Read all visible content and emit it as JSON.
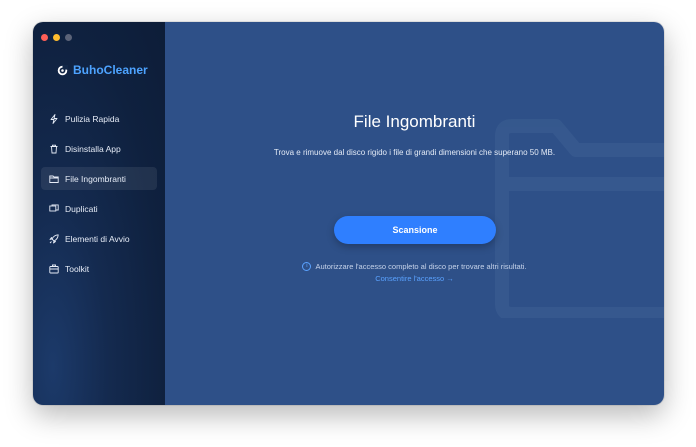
{
  "app": {
    "name": "BuhoCleaner",
    "accent_color": "#2f7fff",
    "brand_color": "#4da3ff"
  },
  "window_controls": [
    "close",
    "minimize",
    "zoom"
  ],
  "sidebar": {
    "items": [
      {
        "label": "Pulizia Rapida",
        "icon": "lightning-icon",
        "active": false
      },
      {
        "label": "Disinstalla App",
        "icon": "trash-icon",
        "active": false
      },
      {
        "label": "File Ingombranti",
        "icon": "folder-icon",
        "active": true
      },
      {
        "label": "Duplicati",
        "icon": "duplicate-icon",
        "active": false
      },
      {
        "label": "Elementi di Avvio",
        "icon": "rocket-icon",
        "active": false
      },
      {
        "label": "Toolkit",
        "icon": "toolkit-icon",
        "active": false
      }
    ]
  },
  "main": {
    "title": "File Ingombranti",
    "subtitle": "Trova e rimuove dal disco rigido i file di grandi dimensioni che superano 50 MB.",
    "scan_button": "Scansione",
    "notice": "Autorizzare l'accesso completo al disco per trovare altri risultati.",
    "allow_link": "Consentire l'accesso →",
    "background_color": "#2e5088"
  }
}
